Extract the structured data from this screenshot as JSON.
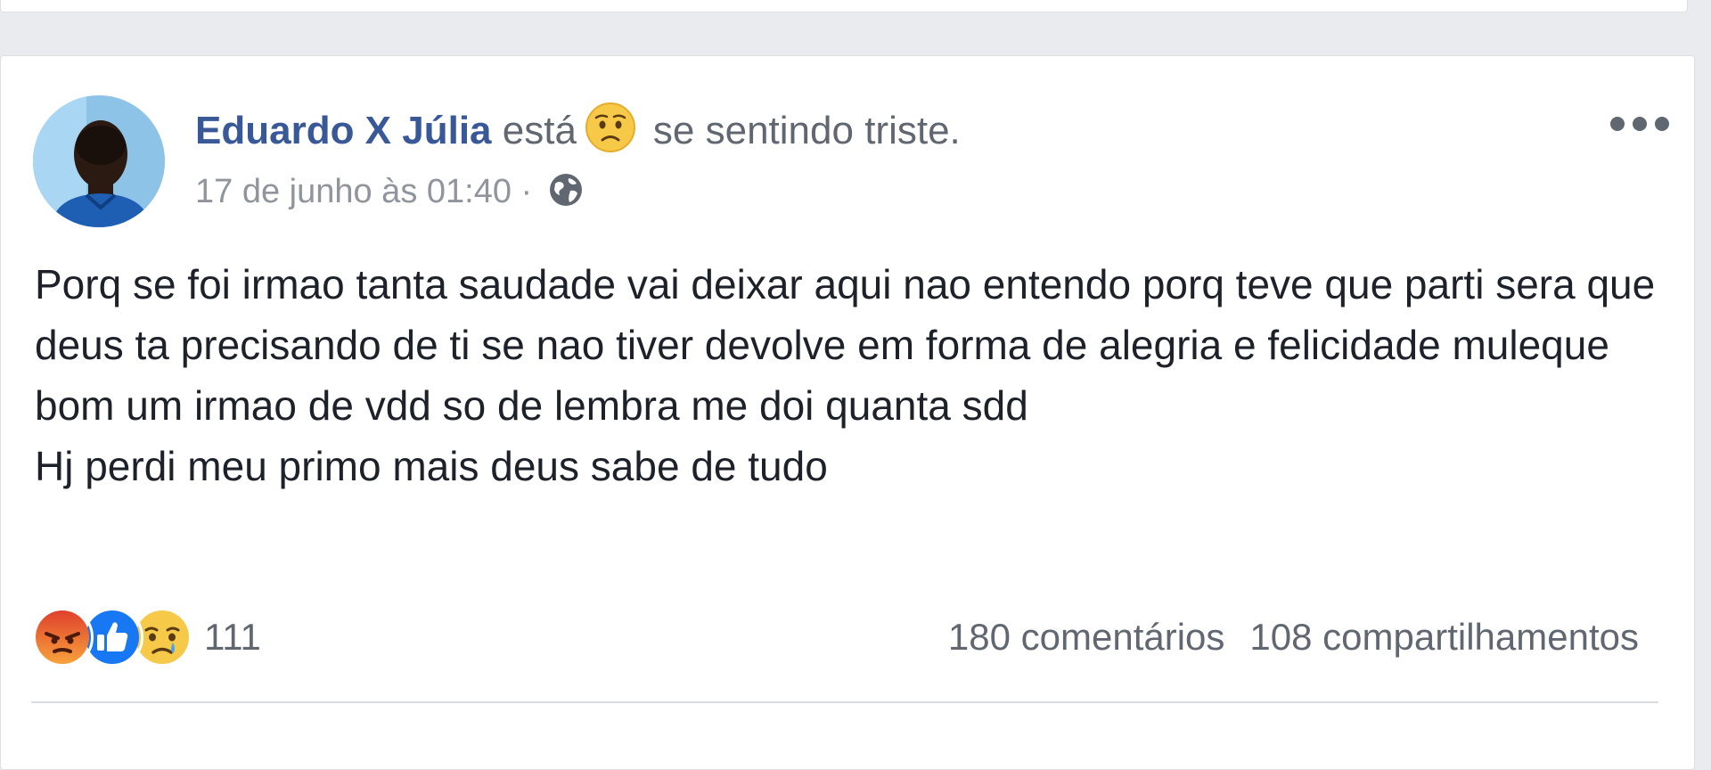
{
  "post": {
    "author": "Eduardo X Júlia",
    "verb": "está",
    "feeling": "se sentindo triste.",
    "feeling_icon": "sad-face-icon",
    "timestamp": "17 de junho às 01:40",
    "separator": "·",
    "privacy_icon": "globe-icon",
    "more_icon": "more-options-icon",
    "body_lines": [
      "Porq se foi irmao tanta saudade vai deixar aqui nao entendo porq teve que parti sera que deus ta precisando de ti se nao tiver devolve em forma de alegria e felicidade muleque bom um irmao de vdd so de lembra me doi quanta sdd",
      "Hj perdi meu primo mais deus sabe de tudo"
    ]
  },
  "reactions": {
    "icons": [
      "angry-reaction-icon",
      "like-reaction-icon",
      "sad-reaction-icon"
    ],
    "count": "111"
  },
  "stats": {
    "comments": "180 comentários",
    "shares": "108 compartilhamentos"
  },
  "colors": {
    "author_link": "#385898",
    "secondary_text": "#606770",
    "like_blue": "#1877f2",
    "angry_orange": "#f0683f",
    "sad_yellow": "#f7c948"
  }
}
